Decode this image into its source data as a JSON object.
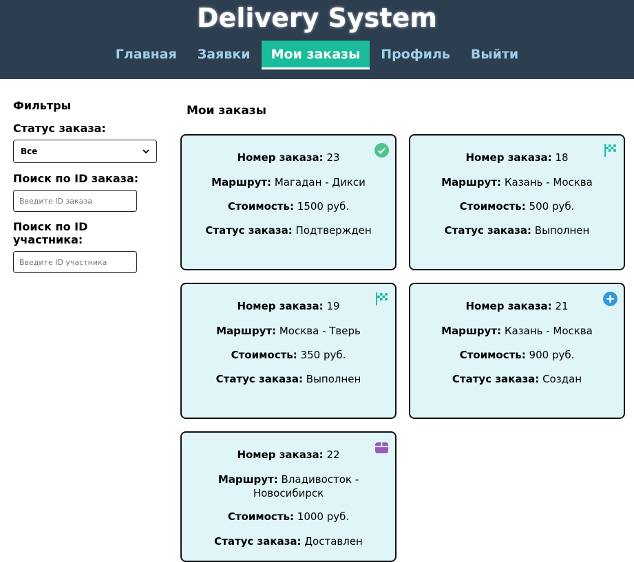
{
  "app": {
    "title": "Delivery System"
  },
  "nav": [
    {
      "label": "Главная"
    },
    {
      "label": "Заявки"
    },
    {
      "label": "Мои заказы"
    },
    {
      "label": "Профиль"
    },
    {
      "label": "Выйти"
    }
  ],
  "sidebar": {
    "filters_title": "Фильтры",
    "status_label": "Статус заказа:",
    "status_value": "Все",
    "order_id_label": "Поиск по ID заказа:",
    "order_id_placeholder": "Введите ID заказа",
    "participant_id_label": "Поиск по ID участника:",
    "participant_id_placeholder": "Введите ID участника"
  },
  "main": {
    "title": "Мои заказы"
  },
  "labels": {
    "order_number": "Номер заказа:",
    "route": "Маршрут:",
    "cost": "Стоимость:",
    "status": "Статус заказа:"
  },
  "orders": [
    {
      "id": "23",
      "route": "Магадан - Дикси",
      "cost": "1500 руб.",
      "status": "Подтвержден",
      "icon": "check-circle-icon",
      "icon_color": "#4cc38a"
    },
    {
      "id": "18",
      "route": "Казань - Москва",
      "cost": "500 руб.",
      "status": "Выполнен",
      "icon": "checkered-flag-icon",
      "icon_color": "#1abc9c"
    },
    {
      "id": "19",
      "route": "Москва - Тверь",
      "cost": "350 руб.",
      "status": "Выполнен",
      "icon": "checkered-flag-icon",
      "icon_color": "#1abc9c"
    },
    {
      "id": "21",
      "route": "Казань - Москва",
      "cost": "900 руб.",
      "status": "Создан",
      "icon": "plus-circle-icon",
      "icon_color": "#3498db"
    },
    {
      "id": "22",
      "route": "Владивосток - Новосибирск",
      "cost": "1000 руб.",
      "status": "Доставлен",
      "icon": "package-icon",
      "icon_color": "#9b59b6"
    }
  ],
  "colors": {
    "header_bg": "#2c3e50",
    "nav_active": "#1abc9c",
    "nav_text": "#9ecfe8",
    "card_bg": "#dff5f8"
  }
}
